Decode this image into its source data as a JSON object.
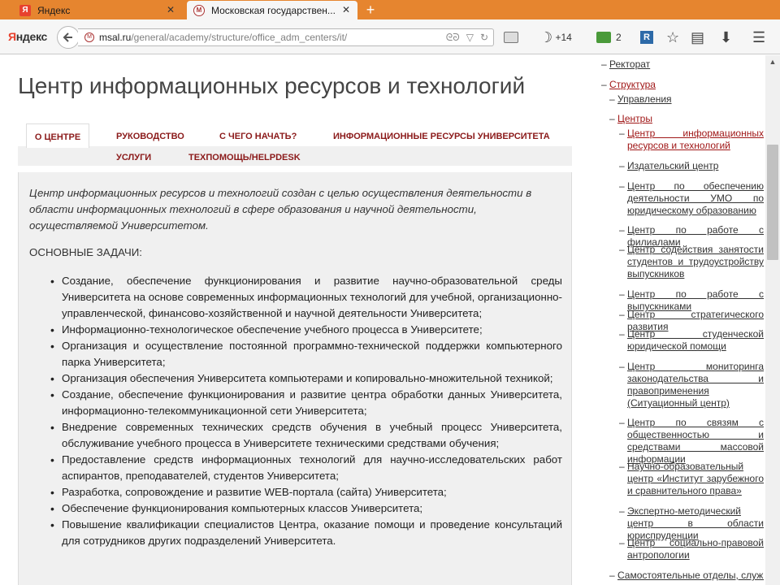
{
  "browser": {
    "tabs": [
      {
        "title": "Яндекс",
        "favicon": "yandex-icon",
        "active": false
      },
      {
        "title": "Московская государствен...",
        "favicon": "msal-icon",
        "active": true
      }
    ],
    "new_tab_label": "+",
    "close_glyph": "✕",
    "logo": {
      "first": "Я",
      "rest": "ндекс"
    },
    "url": {
      "host": "msal.ru",
      "path": "/general/academy/structure/office_adm_centers/it/"
    },
    "weather": "+14",
    "mail_count": "2",
    "icons": [
      "mail-icon",
      "weather-icon",
      "yandex-mail-icon",
      "r-extension-icon",
      "bookmark-star-icon",
      "reading-list-icon",
      "download-icon",
      "menu-icon"
    ],
    "accent": "#e6852f"
  },
  "page": {
    "title": "Центр информационных ресурсов и технологий",
    "tabs": [
      {
        "label": "О ЦЕНТРЕ",
        "active": true
      },
      {
        "label": "РУКОВОДСТВО",
        "active": false
      },
      {
        "label": "С ЧЕГО НАЧАТЬ?",
        "active": false
      },
      {
        "label": "ИНФОРМАЦИОННЫЕ РЕСУРСЫ УНИВЕРСИТЕТА",
        "active": false
      },
      {
        "label": "УСЛУГИ",
        "active": false
      },
      {
        "label": "ТЕХПОМОЩЬ/HELPDESK",
        "active": false
      }
    ],
    "intro": "Центр информационных ресурсов и технологий создан с целью осуществления деятельности в области информационных технологий в сфере образования и научной деятельности, осуществляемой Университетом.",
    "tasks_heading": "ОСНОВНЫЕ ЗАДАЧИ:",
    "tasks": [
      "Создание, обеспечение функционирования и развитие научно-образовательной среды Университета на основе современных информационных технологий для учебной, организационно-управленческой, финансово-хозяйственной и научной деятельности Университета;",
      "Информационно-технологическое обеспечение учебного процесса в Университете;",
      "Организация и осуществление постоянной программно-технической поддержки компьютерного парка Университета;",
      "Организация обеспечения Университета компьютерами и копировально-множительной техникой;",
      "Создание, обеспечение функционирования и развитие центра обработки данных Университета, информационно-телекоммуникационной сети Университета;",
      "Внедрение современных технических средств обучения в учебный процесс Университета, обслуживание учебного процесса в Университете техническими средствами обучения;",
      "Предоставление средств информационных технологий для научно-исследовательских работ аспирантов, преподавателей, студентов Университета;",
      "Разработка, сопровождение и развитие WEB-портала (сайта) Университета;",
      "Обеспечение функционирования компьютерных классов Университета;",
      "Повышение квалификации специалистов Центра, оказание помощи и проведение консультаций для сотрудников других подразделений Университета."
    ]
  },
  "sidebar": {
    "dash": "–",
    "items": [
      {
        "label": "Ректорат",
        "level": 0,
        "red": false
      },
      {
        "label": "Структура",
        "level": 0,
        "red": true
      },
      {
        "label": "Управления",
        "level": 1,
        "red": false
      },
      {
        "label": "Центры",
        "level": 1,
        "red": true
      },
      {
        "label": "Центр информационных ресурсов и технологий",
        "level": 2,
        "red": true
      },
      {
        "label": "Издательский центр",
        "level": 2,
        "red": false
      },
      {
        "label": "Центр по обеспечению деятельности УМО по юридическому образованию",
        "level": 2,
        "red": false
      },
      {
        "label": "Центр по работе с филиалами",
        "level": 2,
        "red": false
      },
      {
        "label": "Центр содействия занятости студентов и трудоустройству выпускников",
        "level": 2,
        "red": false
      },
      {
        "label": "Центр по работе с выпускниками",
        "level": 2,
        "red": false
      },
      {
        "label": "Центр стратегического развития",
        "level": 2,
        "red": false
      },
      {
        "label": "Центр студенческой юридической помощи",
        "level": 2,
        "red": false
      },
      {
        "label": "Центр мониторинга законодательства и правоприменения (Ситуационный центр)",
        "level": 2,
        "red": false
      },
      {
        "label": "Центр по связям с общественностью и средствами массовой информации",
        "level": 2,
        "red": false
      },
      {
        "label": "Научно-образовательный центр «Институт зарубежного и сравнительного права»",
        "level": 2,
        "red": false
      },
      {
        "label": "Экспертно-методический центр в области юриспруденции",
        "level": 2,
        "red": false
      },
      {
        "label": "Центр социально-правовой антропологии",
        "level": 2,
        "red": false
      },
      {
        "label": "Самостоятельные отделы, службы",
        "level": 1,
        "red": false
      }
    ]
  }
}
